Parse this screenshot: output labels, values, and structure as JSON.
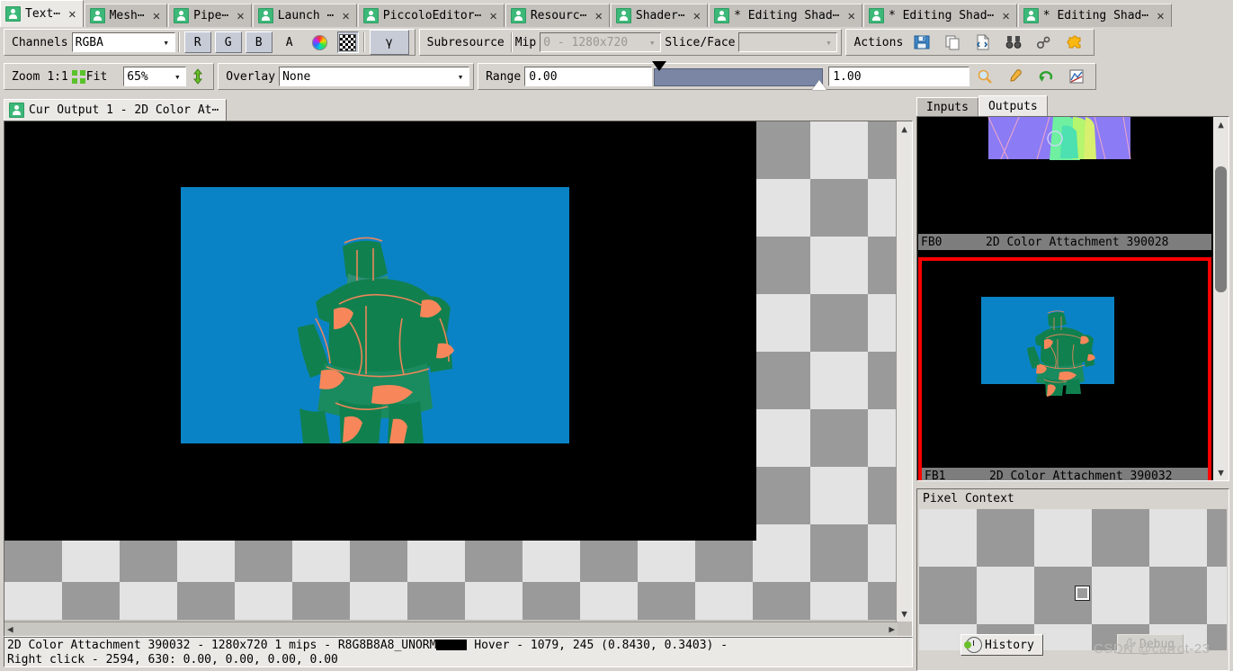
{
  "window_tabs": [
    {
      "label": "Text⋯",
      "active": true,
      "close": "✕"
    },
    {
      "label": "Mesh⋯",
      "active": false,
      "close": "✕"
    },
    {
      "label": "Pipe⋯",
      "active": false,
      "close": "✕"
    },
    {
      "label": "Launch ⋯",
      "active": false,
      "close": "✕"
    },
    {
      "label": "PiccoloEditor⋯",
      "active": false,
      "close": "✕"
    },
    {
      "label": "Resourc⋯",
      "active": false,
      "close": "✕"
    },
    {
      "label": "Shader⋯",
      "active": false,
      "close": "✕"
    },
    {
      "label": "* Editing Shad⋯",
      "active": false,
      "close": "✕"
    },
    {
      "label": "* Editing Shad⋯",
      "active": false,
      "close": "✕"
    },
    {
      "label": "* Editing Shad⋯",
      "active": false,
      "close": "✕"
    }
  ],
  "toolbar_channels": {
    "channels_label": "Channels",
    "channels_value": "RGBA",
    "arrow": "⌄",
    "btn_r": "R",
    "btn_g": "G",
    "btn_b": "B",
    "btn_a": "A",
    "gamma": "γ",
    "subresource_label": "Subresource",
    "mip_label": "Mip",
    "mip_value": "0 - 1280x720",
    "slice_label": "Slice/Face",
    "slice_value": "",
    "actions_label": "Actions"
  },
  "toolbar_view": {
    "zoom_label": "Zoom",
    "one_to_one": "1:1",
    "fit_label": "Fit",
    "zoom_value": "65%",
    "overlay_label": "Overlay",
    "overlay_value": "None",
    "range_label": "Range",
    "range_min": "0.00",
    "range_max": "1.00"
  },
  "viewport": {
    "tab_label": "Cur Output 1 - 2D Color At⋯"
  },
  "status": {
    "line1_prefix": "2D Color Attachment 390032 - 1280x720 1 mips - R8G8B8A8_UNORM",
    "line1_suffix": "Hover -   1079,   245 (0.8430, 0.3403)   -",
    "line2": "Right click - 2594,   630: 0.00, 0.00, 0.00, 0.00"
  },
  "right_panel": {
    "tabs": [
      {
        "label": "Inputs",
        "active": false
      },
      {
        "label": "Outputs",
        "active": true
      }
    ],
    "thumbnails": [
      {
        "name": "FB0",
        "title": "2D Color Attachment 390028",
        "selected": false
      },
      {
        "name": "FB1",
        "title": "2D Color Attachment 390032",
        "selected": true
      }
    ],
    "pixel_context": {
      "title": "Pixel Context",
      "history_label": "History",
      "debug_label": "Debug"
    }
  },
  "watermark": "CSDN @carrot-23",
  "colors": {
    "accent_green": "#3cb878",
    "selection_red": "#ff0000",
    "image_bg_blue": "#0a83c6",
    "figure_green": "#11804f",
    "figure_orange": "#f7875a"
  }
}
